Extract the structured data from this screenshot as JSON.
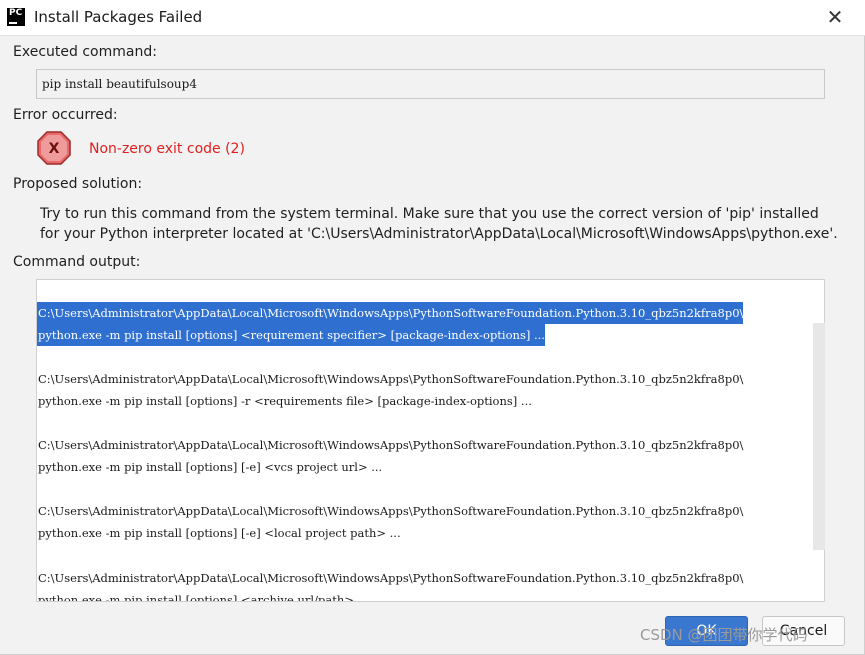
{
  "window": {
    "title": "Install Packages Failed",
    "app_icon_text": "PC",
    "close_glyph": "✕"
  },
  "executed": {
    "label": "Executed command:",
    "command": "pip install beautifulsoup4"
  },
  "error": {
    "label": "Error occurred:",
    "icon_glyph": "X",
    "message": "Non-zero exit code (2)"
  },
  "solution": {
    "label": "Proposed solution:",
    "text": "Try to run this command from the system terminal. Make sure that you use the correct version of 'pip' installed for your Python interpreter located at 'C:\\Users\\Administrator\\AppData\\Local\\Microsoft\\WindowsApps\\python.exe'."
  },
  "output": {
    "label": "Command output:",
    "lines": [
      "C:\\Users\\Administrator\\AppData\\Local\\Microsoft\\WindowsApps\\PythonSoftwareFoundation.Python.3.10_qbz5n2kfra8p0\\",
      "python.exe -m pip install [options] <requirement specifier> [package-index-options] ...",
      "C:\\Users\\Administrator\\AppData\\Local\\Microsoft\\WindowsApps\\PythonSoftwareFoundation.Python.3.10_qbz5n2kfra8p0\\",
      "python.exe -m pip install [options] -r <requirements file> [package-index-options] ...",
      "C:\\Users\\Administrator\\AppData\\Local\\Microsoft\\WindowsApps\\PythonSoftwareFoundation.Python.3.10_qbz5n2kfra8p0\\",
      "python.exe -m pip install [options] [-e] <vcs project url> ...",
      "C:\\Users\\Administrator\\AppData\\Local\\Microsoft\\WindowsApps\\PythonSoftwareFoundation.Python.3.10_qbz5n2kfra8p0\\",
      "python.exe -m pip install [options] [-e] <local project path> ...",
      "C:\\Users\\Administrator\\AppData\\Local\\Microsoft\\WindowsApps\\PythonSoftwareFoundation.Python.3.10_qbz5n2kfra8p0\\",
      "python.exe -m pip install [options] <archive url/path> ..."
    ]
  },
  "buttons": {
    "ok": "OK",
    "cancel": "Cancel"
  },
  "watermark": "CSDN @团团带你学代码",
  "colors": {
    "selection": "#2f6fd0",
    "error_text": "#e02020",
    "ok_button": "#3a78d0"
  }
}
